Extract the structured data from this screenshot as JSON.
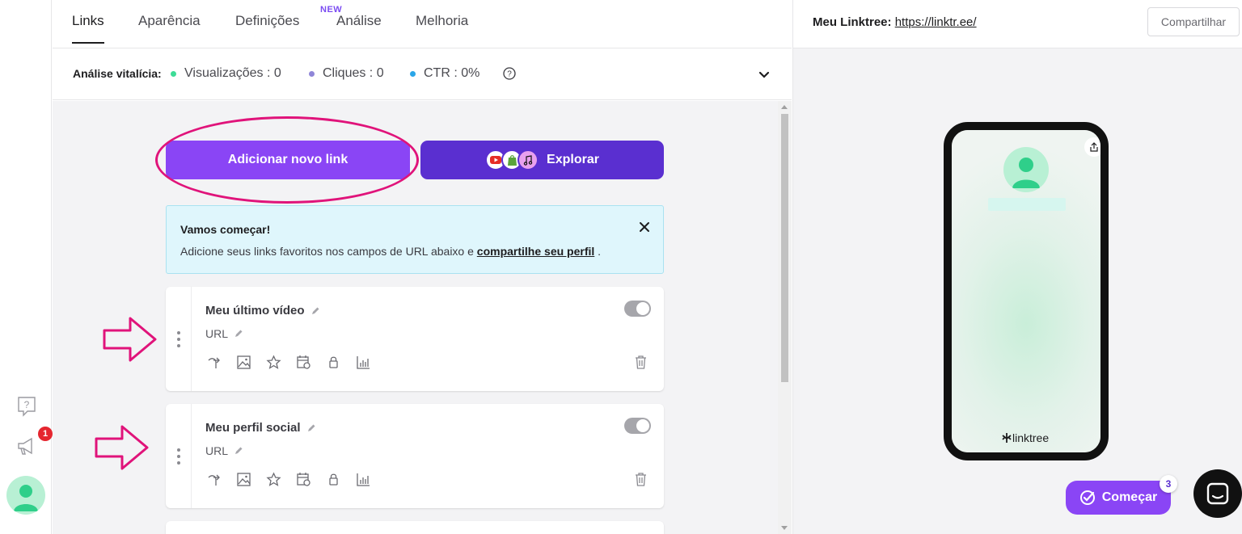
{
  "tabs": [
    {
      "label": "Links"
    },
    {
      "label": "Aparência"
    },
    {
      "label": "Definições"
    },
    {
      "label": "Análise"
    },
    {
      "label": "Melhoria"
    }
  ],
  "tab_new_badge": "NEW",
  "analytics": {
    "label": "Análise vitalícia:",
    "views": "Visualizações : 0",
    "clicks": "Cliques : 0",
    "ctr": "CTR : 0%",
    "colors": {
      "views": "#3ddc97",
      "clicks": "#8f86d8",
      "ctr": "#2aa6e8"
    }
  },
  "actions": {
    "add_link": "Adicionar novo link",
    "explore": "Explorar"
  },
  "banner": {
    "title": "Vamos começar!",
    "text_before": "Adicione seus links favoritos nos campos de URL abaixo e ",
    "link": "compartilhe seu perfil",
    "text_after": " ."
  },
  "cards": [
    {
      "title": "Meu último vídeo",
      "url": "URL",
      "enabled": true
    },
    {
      "title": "Meu perfil social",
      "url": "URL",
      "enabled": true
    }
  ],
  "preview": {
    "label": "Meu Linktree:",
    "url": "https://linktr.ee/",
    "share": "Compartilhar",
    "logo": "linktree"
  },
  "start": {
    "label": "Começar",
    "count": "3"
  },
  "rail": {
    "notifications": "1"
  },
  "colors": {
    "accent": "#8a45f5",
    "explore": "#5a2fd0",
    "annotation": "#e0137a"
  }
}
